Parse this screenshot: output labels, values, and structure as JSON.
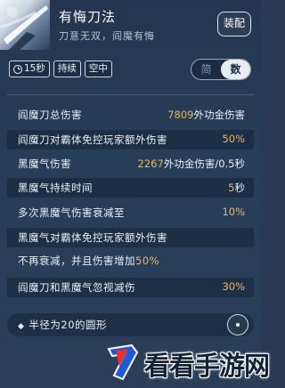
{
  "header": {
    "title": "有悔刀法",
    "subtitle": "刀意无双，阎魔有悔",
    "equip_label": "装配"
  },
  "tags": [
    {
      "icon": "clock-icon",
      "label": "15秒"
    },
    {
      "label": "持续"
    },
    {
      "label": "空中"
    }
  ],
  "view_toggle": {
    "simple": "简",
    "detail": "数",
    "selected": "数"
  },
  "stats": [
    {
      "label": "阎魔刀总伤害",
      "num": "7809",
      "unit": "外功金伤害"
    },
    {
      "label": "阎魔刀对霸体免控玩家额外伤害",
      "num": "50%",
      "unit": ""
    },
    {
      "label": "黑魔气伤害",
      "num": "2267",
      "unit": "外功金伤害/0.5秒"
    },
    {
      "label": "黑魔气持续时间",
      "num": "5",
      "unit": "秒"
    },
    {
      "label": "多次黑魔气伤害衰减至",
      "num": "10%",
      "unit": ""
    },
    {
      "label": "黑魔气对霸体免控玩家额外伤害",
      "num": "",
      "unit": ""
    },
    {
      "label": "阎魔刀和黑魔气忽视减伤",
      "num": "30%",
      "unit": ""
    }
  ],
  "note": {
    "text": "不再衰减，并且伤害增加",
    "num": "50%"
  },
  "shape": {
    "label": "半径为20的圆形"
  },
  "watermark": {
    "text": "看看手游网"
  },
  "colors": {
    "accent": "#e9b75f",
    "background": "#283d57",
    "text": "#e9eff6"
  }
}
